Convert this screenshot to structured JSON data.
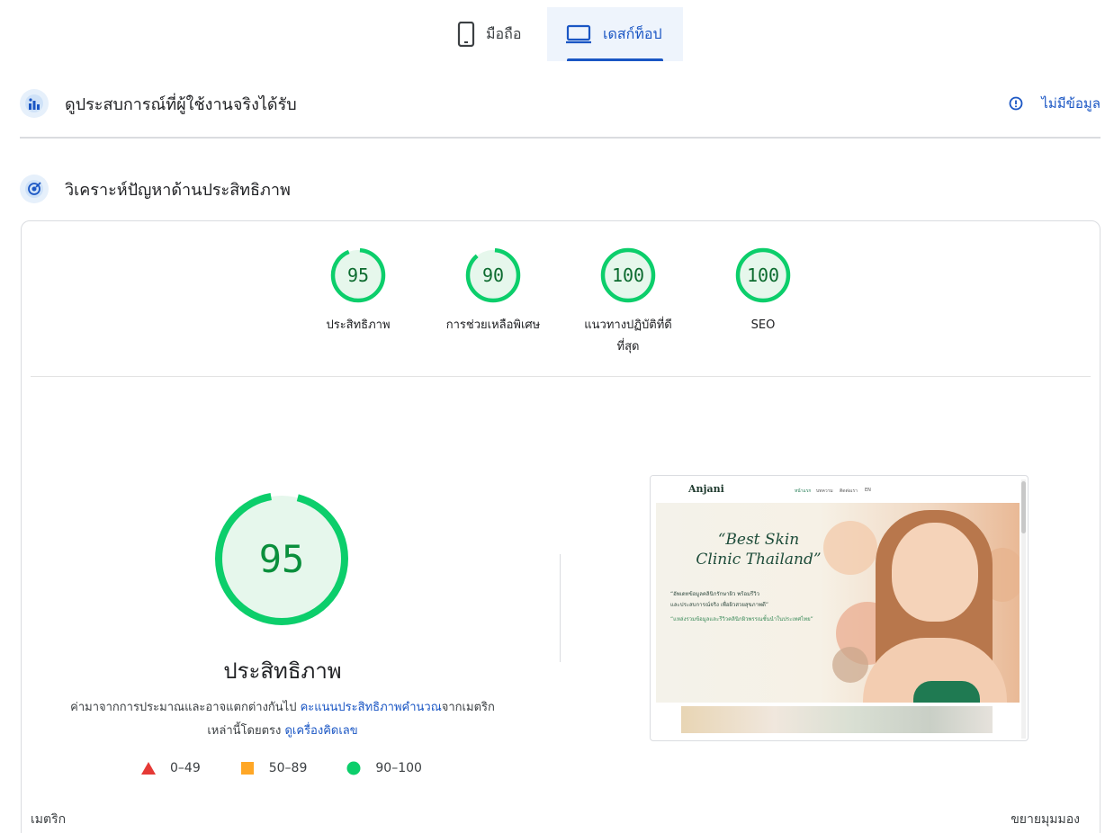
{
  "tabs": [
    {
      "label": "มือถือ",
      "icon": "phone-icon",
      "selected": false
    },
    {
      "label": "เดสก์ท็อป",
      "icon": "laptop-icon",
      "selected": true
    }
  ],
  "field_data": {
    "title": "ดูประสบการณ์ที่ผู้ใช้งานจริงได้รับ",
    "no_data_label": "ไม่มีข้อมูล",
    "icon": "field-data-icon"
  },
  "diagnose": {
    "title": "วิเคราะห์ปัญหาด้านประสิทธิภาพ",
    "icon": "diagnose-icon"
  },
  "scores": [
    {
      "value": "95",
      "label": "ประสิทธิภาพ",
      "fraction": 0.95
    },
    {
      "value": "90",
      "label": "การช่วยเหลือพิเศษ",
      "fraction": 0.9
    },
    {
      "value": "100",
      "label_line1": "แนวทางปฏิบัติที่ดี",
      "label_line2": "ที่สุด",
      "fraction": 1.0
    },
    {
      "value": "100",
      "label": "SEO",
      "fraction": 1.0
    }
  ],
  "performance": {
    "score": "95",
    "fraction": 0.95,
    "title": "ประสิทธิภาพ",
    "desc_part1": "ค่ามาจากการประมาณและอาจแตกต่างกันไป ",
    "desc_link1": "คะแนนประสิทธิภาพคำนวณ",
    "desc_part2": "จากเมตริกเหล่านี้โดยตรง ",
    "desc_link2": "ดูเครื่องคิดเลข"
  },
  "legend": [
    {
      "range": "0–49",
      "color": "#e53935",
      "shape": "triangle"
    },
    {
      "range": "50–89",
      "color": "#ffa726",
      "shape": "square"
    },
    {
      "range": "90–100",
      "color": "#0cce6b",
      "shape": "circle"
    }
  ],
  "thumbnail": {
    "logo": "Anjani",
    "nav_items": [
      "หน้าแรก",
      "บทความ",
      "ติดต่อเรา",
      "EN"
    ],
    "hero_title_line1": "“Best Skin",
    "hero_title_line2": "Clinic Thailand”",
    "hero_sub_line1": "“อัพเดทข้อมูลคลินิกรักษาผิว พร้อมรีวิว",
    "hero_sub_line2": "และประสบการณ์จริง เพื่อผิวสวยสุขภาพดี”",
    "hero_sub_green": "“แหล่งรวมข้อมูลและรีวิวคลินิกผิวพรรณชั้นนำในประเทศไทย”"
  },
  "footer": {
    "metrics_label": "เมตริก",
    "expand_label": "ขยายมุมมอง"
  },
  "colors": {
    "accent_blue": "#1a56c4",
    "pass_green": "#0cce6b",
    "pass_fill": "#e6f7ec"
  }
}
